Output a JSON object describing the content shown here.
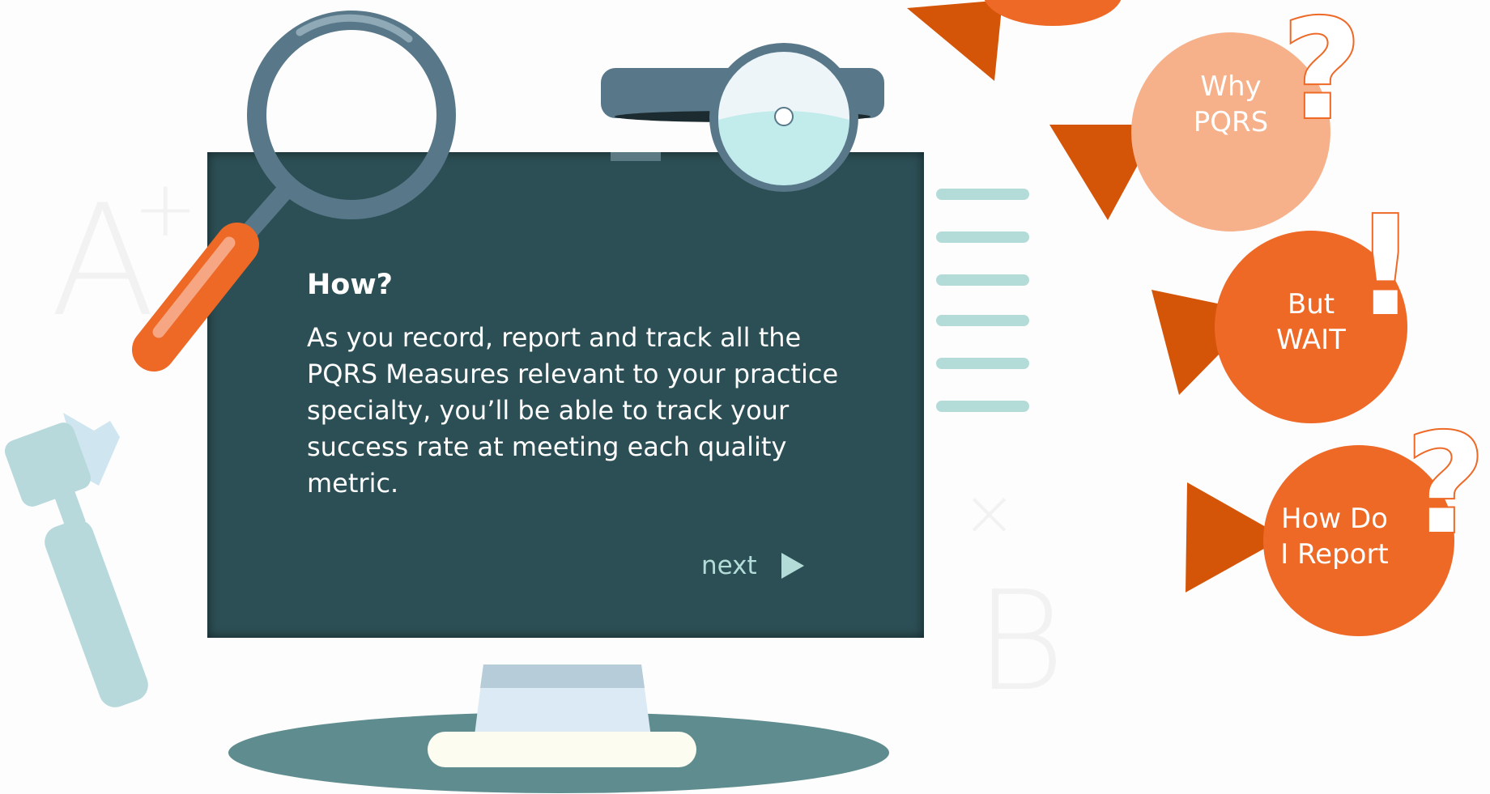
{
  "slide": {
    "heading": "How?",
    "body": "As you record, report and track all the PQRS Measures relevant to your practice specialty, you’ll be able to track your success rate at meeting each quality metric.",
    "next_label": "next"
  },
  "menu": [
    {
      "label_line1": "Why",
      "label_line2": "PQRS",
      "mark": "?"
    },
    {
      "label_line1": "But",
      "label_line2": "WAIT",
      "mark": "!"
    },
    {
      "label_line1": "How Do",
      "label_line2": "I Report",
      "mark": "?"
    }
  ],
  "decorations": {
    "grade_letter": "A",
    "grade_modifier": "+",
    "letter_b": "B",
    "times_sign": "×"
  },
  "icons": [
    "magnifying-glass-icon",
    "head-mirror-icon",
    "otoscope-icon",
    "play-arrow-icon"
  ],
  "colors": {
    "screen": "#2c4f55",
    "accent_orange": "#ee6826",
    "dark_orange": "#d45508",
    "light_orange": "#f6b08a",
    "mint": "#b3dcd8"
  }
}
